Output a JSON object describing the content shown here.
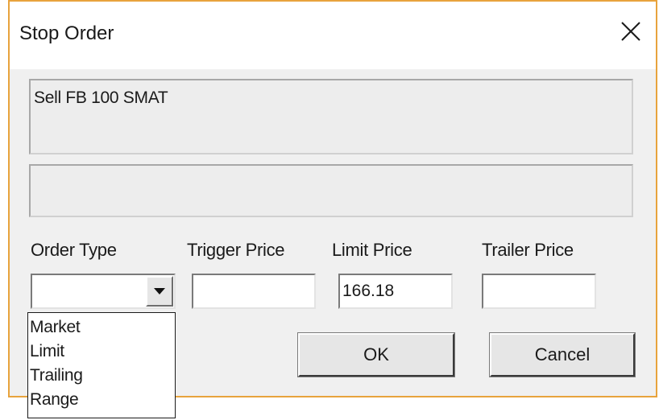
{
  "window": {
    "title": "Stop Order",
    "close_icon": "close-icon",
    "border_color": "#e8a33d"
  },
  "message": {
    "line1": "Sell FB 100 SMAT",
    "line2": ""
  },
  "fields": {
    "order_type_label": "Order Type",
    "trigger_price_label": "Trigger Price",
    "limit_price_label": "Limit Price",
    "trailer_price_label": "Trailer Price",
    "order_type_value": "",
    "trigger_price_value": "",
    "limit_price_value": "166.18",
    "trailer_price_value": ""
  },
  "dropdown": {
    "open": true,
    "options": [
      "Market",
      "Limit",
      "Trailing",
      "Range"
    ]
  },
  "buttons": {
    "ok_label": "OK",
    "cancel_label": "Cancel"
  }
}
